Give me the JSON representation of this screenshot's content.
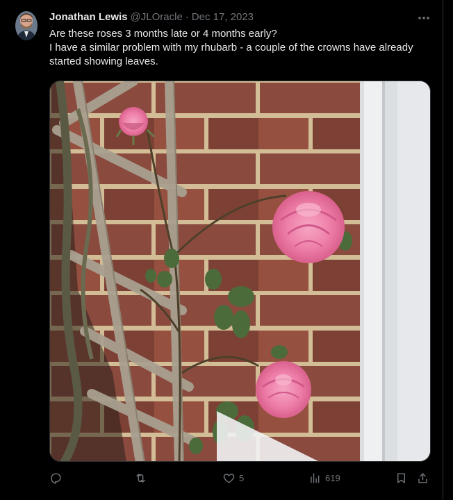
{
  "tweet": {
    "display_name": "Jonathan Lewis",
    "handle": "@JLOracle",
    "separator": "·",
    "timestamp": "Dec 17, 2023",
    "text_line1": "Are these roses 3 months late or 4 months early?",
    "text_line2": "I have a similar problem with my rhubarb - a couple of the crowns have already started showing leaves.",
    "more_icon": "more-horizontal-icon"
  },
  "actions": {
    "reply_count": "",
    "retweet_count": "",
    "like_count": "5",
    "views_count": "619"
  },
  "colors": {
    "background": "#000000",
    "text_primary": "#e7e9ea",
    "text_secondary": "#71767b",
    "border": "#2f3336"
  }
}
